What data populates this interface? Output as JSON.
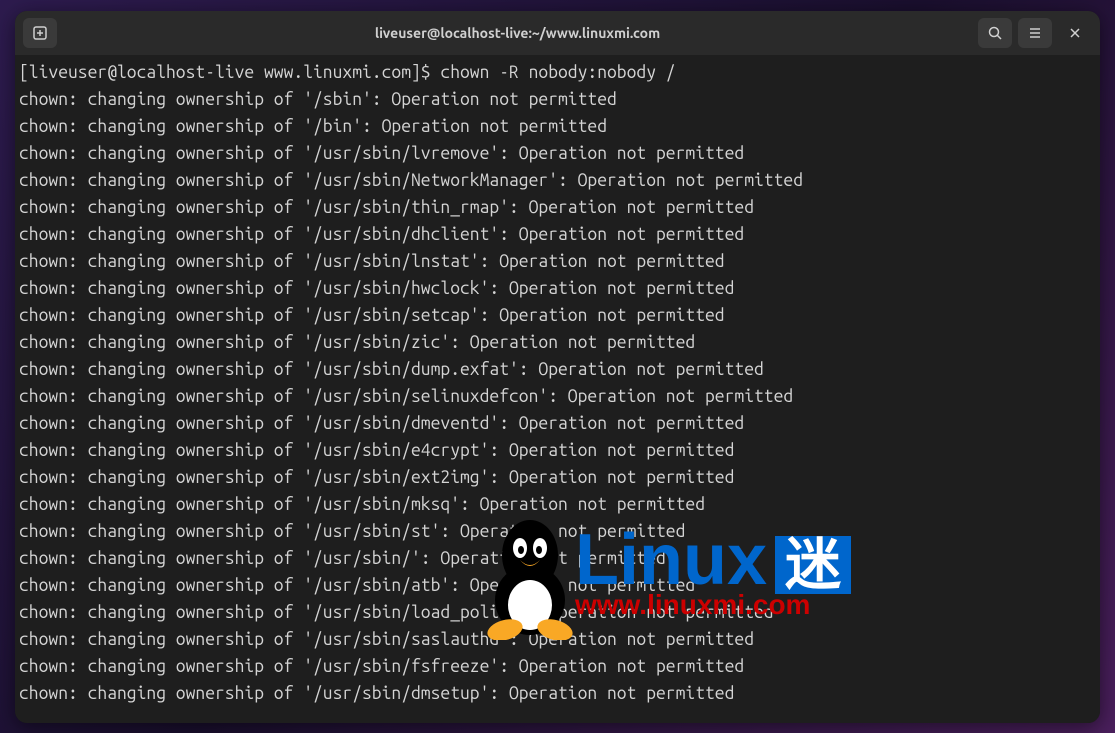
{
  "titlebar": {
    "title": "liveuser@localhost-live:~/www.linuxmi.com"
  },
  "terminal": {
    "prompt": "[liveuser@localhost-live www.linuxmi.com]$ ",
    "command": "chown -R nobody:nobody /",
    "lines": [
      "chown: changing ownership of '/sbin': Operation not permitted",
      "chown: changing ownership of '/bin': Operation not permitted",
      "chown: changing ownership of '/usr/sbin/lvremove': Operation not permitted",
      "chown: changing ownership of '/usr/sbin/NetworkManager': Operation not permitted",
      "chown: changing ownership of '/usr/sbin/thin_rmap': Operation not permitted",
      "chown: changing ownership of '/usr/sbin/dhclient': Operation not permitted",
      "chown: changing ownership of '/usr/sbin/lnstat': Operation not permitted",
      "chown: changing ownership of '/usr/sbin/hwclock': Operation not permitted",
      "chown: changing ownership of '/usr/sbin/setcap': Operation not permitted",
      "chown: changing ownership of '/usr/sbin/zic': Operation not permitted",
      "chown: changing ownership of '/usr/sbin/dump.exfat': Operation not permitted",
      "chown: changing ownership of '/usr/sbin/selinuxdefcon': Operation not permitted",
      "chown: changing ownership of '/usr/sbin/dmeventd': Operation not permitted",
      "chown: changing ownership of '/usr/sbin/e4crypt': Operation not permitted",
      "chown: changing ownership of '/usr/sbin/ext2img': Operation not permitted",
      "chown: changing ownership of '/usr/sbin/mksq': Operation not permitted",
      "chown: changing ownership of '/usr/sbin/st': Operation not permitted",
      "chown: changing ownership of '/usr/sbin/': Operation not permitted",
      "chown: changing ownership of '/usr/sbin/atb': Operation not permitted",
      "chown: changing ownership of '/usr/sbin/load_policy': Operation not permitted",
      "chown: changing ownership of '/usr/sbin/saslauthd': Operation not permitted",
      "chown: changing ownership of '/usr/sbin/fsfreeze': Operation not permitted",
      "chown: changing ownership of '/usr/sbin/dmsetup': Operation not permitted"
    ]
  },
  "watermark": {
    "brand": "Linux",
    "suffix": "迷",
    "url": "www.linuxmi.com"
  }
}
